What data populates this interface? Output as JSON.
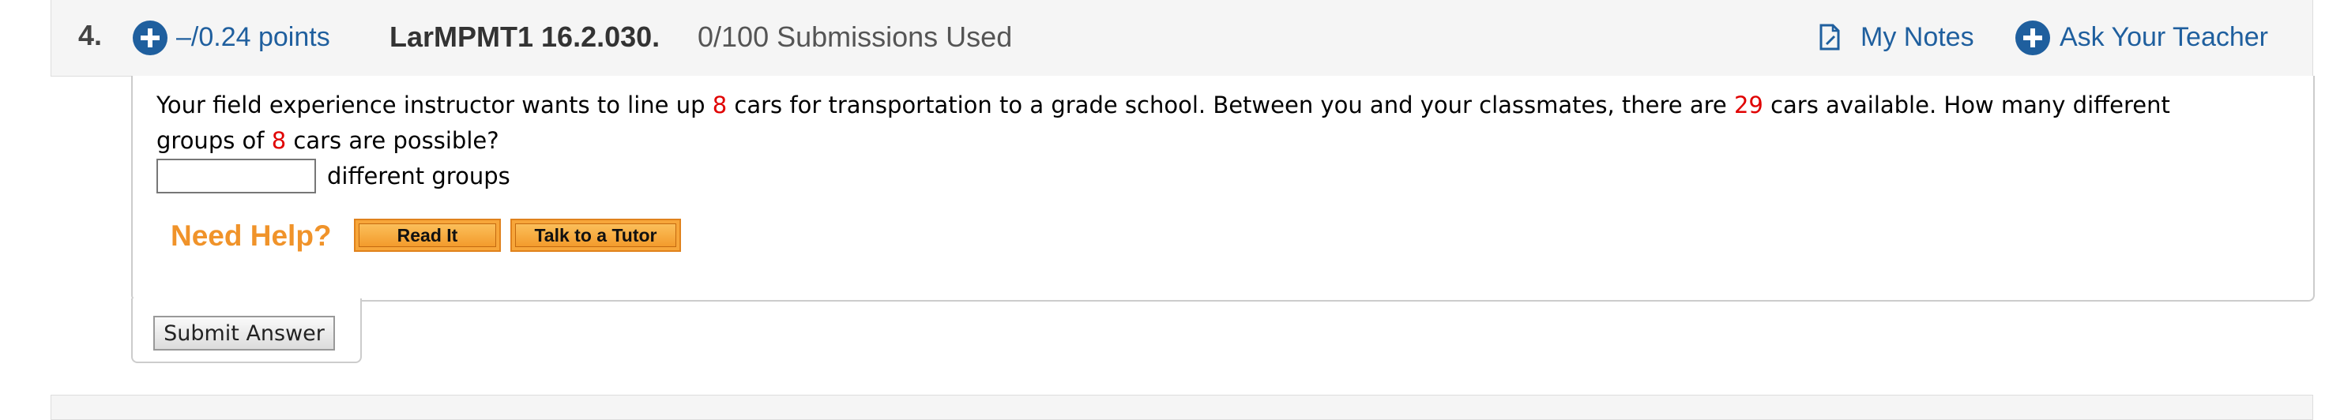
{
  "question": {
    "number": "4.",
    "points_label": "–/0.24 points",
    "problem_id": "LarMPMT1 16.2.030.",
    "submissions": "0/100 Submissions Used",
    "my_notes_label": "My Notes",
    "ask_teacher_label": "Ask Your Teacher",
    "accent_color": "#1f5f9e",
    "highlight_color": "#e00000",
    "icons": [
      "plus-circle-icon",
      "notes-icon"
    ]
  },
  "body": {
    "line1_a": "Your field experience instructor wants to line up ",
    "n_cars": "8",
    "line1_b": " cars for transportation to a grade school. Between you and your classmates, there are ",
    "total_cars": "29",
    "line1_c": " cars available. How many different",
    "line2_a": "groups of ",
    "line2_b": " cars are possible?",
    "answer_value": "",
    "answer_suffix": "different groups"
  },
  "help": {
    "label": "Need Help?",
    "read_it": "Read It",
    "tutor": "Talk to a Tutor",
    "button_color": "#f7a63a",
    "label_color": "#f0932a"
  },
  "submit": {
    "label": "Submit Answer"
  }
}
